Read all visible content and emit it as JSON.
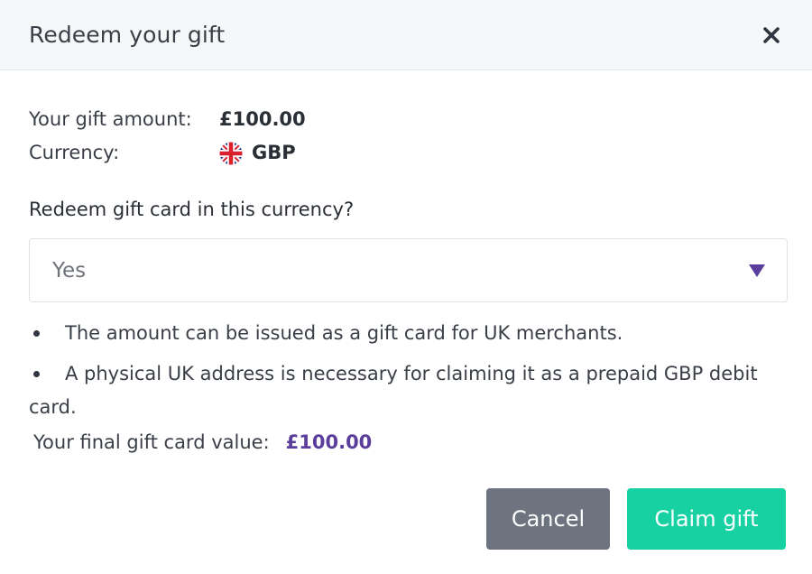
{
  "dialog": {
    "title": "Redeem your gift",
    "close_icon": "close-icon"
  },
  "info": {
    "amount_label": "Your gift amount:",
    "amount_value": "£100.00",
    "currency_label": "Currency:",
    "currency_value": "GBP",
    "currency_flag_icon": "uk-flag-icon"
  },
  "question": "Redeem gift card in this currency?",
  "select": {
    "value": "Yes",
    "arrow_icon": "triangle-down-icon"
  },
  "notes": [
    "The amount can be issued as a gift card for UK merchants.",
    "A physical UK address is necessary for claiming it as a prepaid GBP debit card."
  ],
  "final": {
    "label": "Your final gift card value:",
    "value": "£100.00"
  },
  "buttons": {
    "cancel": "Cancel",
    "claim": "Claim gift"
  },
  "colors": {
    "header_bg": "#f5f7f8",
    "accent_purple": "#5b3d9b",
    "cancel_bg": "#6d7480",
    "claim_bg": "#18d1a3"
  }
}
